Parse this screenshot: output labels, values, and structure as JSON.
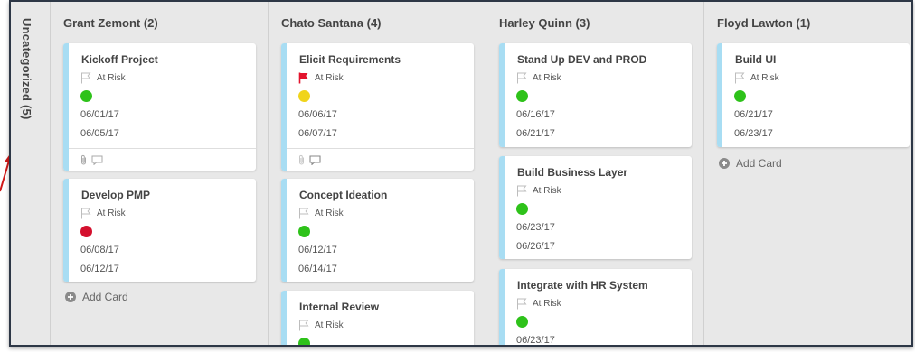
{
  "uncategorized": {
    "label": "Uncategorized (5)"
  },
  "colors": {
    "board_bg": "#e8e8e8",
    "card_accent": "#a8ddf3",
    "status_green": "#2ec21a",
    "status_yellow": "#f0d41b",
    "status_red": "#d4102e",
    "flag_red": "#e3142d",
    "flag_gray": "#bdbdbd"
  },
  "columns": [
    {
      "title": "Grant Zemont (2)",
      "add_card": "Add Card",
      "cards": [
        {
          "title": "Kickoff Project",
          "risk": "At Risk",
          "flag": "gray",
          "status": "green",
          "start": "06/01/17",
          "end": "06/05/17",
          "footer_icons": [
            "paperclip-icon",
            "comment-icon"
          ]
        },
        {
          "title": "Develop PMP",
          "risk": "At Risk",
          "flag": "gray",
          "status": "red",
          "start": "06/08/17",
          "end": "06/12/17"
        }
      ]
    },
    {
      "title": "Chato Santana (4)",
      "cards": [
        {
          "title": "Elicit Requirements",
          "risk": "At Risk",
          "flag": "red",
          "status": "yellow",
          "start": "06/06/17",
          "end": "06/07/17",
          "footer_icons": [
            "paperclip-icon",
            "comment-icon"
          ]
        },
        {
          "title": "Concept Ideation",
          "risk": "At Risk",
          "flag": "gray",
          "status": "green",
          "start": "06/12/17",
          "end": "06/14/17"
        },
        {
          "title": "Internal Review",
          "risk": "At Risk",
          "flag": "gray",
          "status": "green"
        }
      ]
    },
    {
      "title": "Harley Quinn (3)",
      "cards": [
        {
          "title": "Stand Up DEV and PROD",
          "risk": "At Risk",
          "flag": "gray",
          "status": "green",
          "start": "06/16/17",
          "end": "06/21/17"
        },
        {
          "title": "Build Business Layer",
          "risk": "At Risk",
          "flag": "gray",
          "status": "green",
          "start": "06/23/17",
          "end": "06/26/17"
        },
        {
          "title": "Integrate with HR System",
          "risk": "At Risk",
          "flag": "gray",
          "status": "green",
          "start": "06/23/17"
        }
      ]
    },
    {
      "title": "Floyd Lawton (1)",
      "add_card": "Add Card",
      "cards": [
        {
          "title": "Build UI",
          "risk": "At Risk",
          "flag": "gray",
          "status": "green",
          "start": "06/21/17",
          "end": "06/23/17"
        }
      ]
    }
  ]
}
